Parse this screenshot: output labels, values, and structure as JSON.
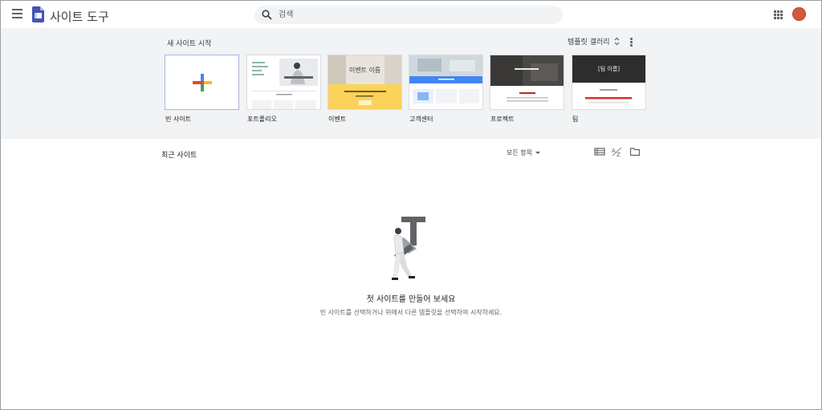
{
  "header": {
    "app_title": "사이트 도구",
    "search_placeholder": "검색",
    "menu_icon": "hamburger-menu-icon",
    "apps_icon": "apps-grid-icon",
    "avatar_color": "#cf5a3e"
  },
  "templates": {
    "section_title": "새 사이트 시작",
    "gallery_label": "템플릿 갤러리",
    "items": [
      {
        "label": "빈 사이트"
      },
      {
        "label": "포트폴리오"
      },
      {
        "label": "이벤트"
      },
      {
        "label": "고객센터"
      },
      {
        "label": "프로젝트"
      },
      {
        "label": "팀"
      }
    ],
    "thumb_text": {
      "event_title": "이벤트 이름",
      "team_title": "[팀 이름]"
    }
  },
  "recent": {
    "section_title": "최근 사이트",
    "filter_label": "모든 항목"
  },
  "empty_state": {
    "title": "첫 사이트를 만들어 보세요",
    "subtitle": "빈 사이트를 선택하거나 위에서 다른 템플릿을 선택하여 시작하세요."
  },
  "colors": {
    "band_bg": "#f1f3f4",
    "plus_blue": "#4285f4",
    "plus_red": "#ea4335",
    "plus_yellow": "#fbbc04",
    "plus_green": "#34a853"
  }
}
